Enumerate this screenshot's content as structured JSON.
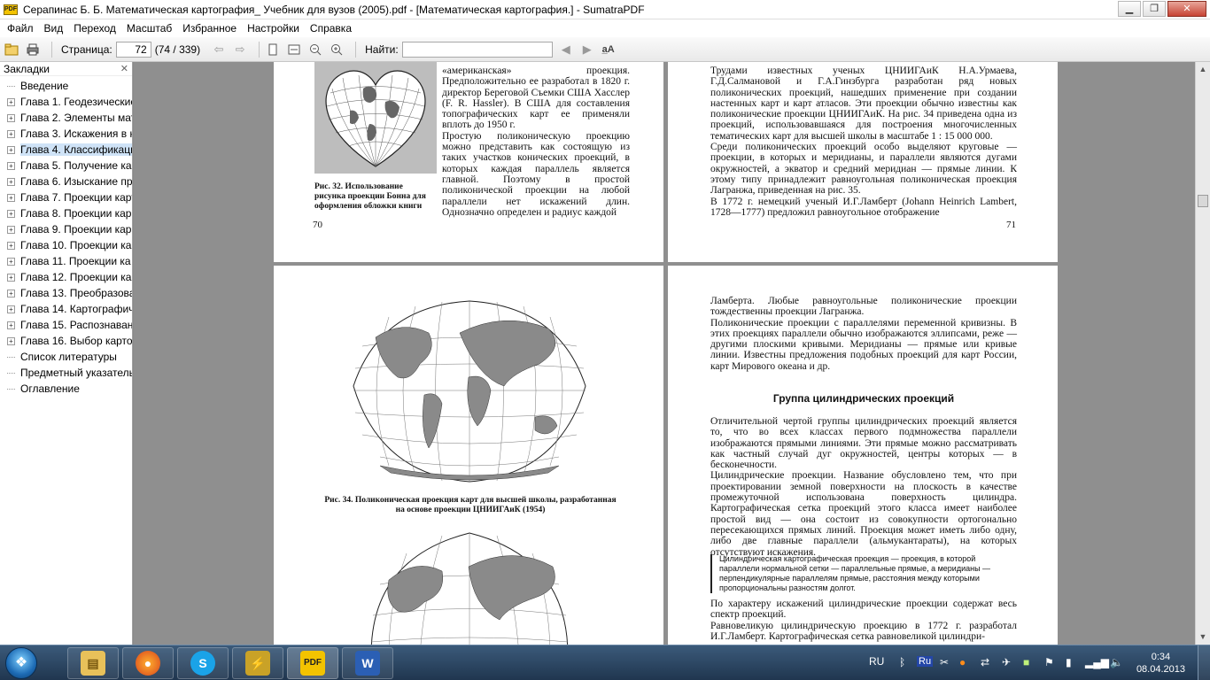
{
  "window": {
    "title": "Серапинас Б. Б. Математическая картография_ Учебник для вузов (2005).pdf - [Математическая картография.] - SumatraPDF",
    "logo_text": "PDF"
  },
  "menu": [
    "Файл",
    "Вид",
    "Переход",
    "Масштаб",
    "Избранное",
    "Настройки",
    "Справка"
  ],
  "toolbar": {
    "page_label": "Страница:",
    "page_value": "72",
    "page_count": "(74 / 339)",
    "find_label": "Найти:",
    "find_value": ""
  },
  "sidebar": {
    "title": "Закладки",
    "items": [
      {
        "label": "Введение",
        "expandable": false
      },
      {
        "label": "Глава 1. Геодезические",
        "expandable": true
      },
      {
        "label": "Глава 2. Элементы мат",
        "expandable": true
      },
      {
        "label": "Глава 3. Искажения в к",
        "expandable": true
      },
      {
        "label": "Глава 4. Классификаци",
        "expandable": true,
        "selected": true
      },
      {
        "label": "Глава 5. Получение ка",
        "expandable": true
      },
      {
        "label": "Глава 6. Изыскание пр",
        "expandable": true
      },
      {
        "label": "Глава 7. Проекции карт",
        "expandable": true
      },
      {
        "label": "Глава 8. Проекции кар",
        "expandable": true
      },
      {
        "label": "Глава 9. Проекции кар",
        "expandable": true
      },
      {
        "label": "Глава 10. Проекции ка",
        "expandable": true
      },
      {
        "label": "Глава 11. Проекции ка",
        "expandable": true
      },
      {
        "label": "Глава 12. Проекции ка",
        "expandable": true
      },
      {
        "label": "Глава 13. Преобразова",
        "expandable": true
      },
      {
        "label": "Глава 14. Картографич",
        "expandable": true
      },
      {
        "label": "Глава 15. Распознавани",
        "expandable": true
      },
      {
        "label": "Глава 16. Выбор карто",
        "expandable": true
      },
      {
        "label": "Список литературы",
        "expandable": false
      },
      {
        "label": "Предметный указатель",
        "expandable": false
      },
      {
        "label": "Оглавление",
        "expandable": false
      }
    ]
  },
  "pages": {
    "p70": {
      "text": "«американская» проекция. Предположительно ее разработал в 1820 г. директор Береговой Съемки США Хасслер (F. R. Hassler). В США для составления топографических карт ее применяли вплоть до 1950 г.\nПростую поликоническую проекцию можно представить как состоящую из таких участков конических проекций, в которых каждая параллель является главной. Поэтому в простой поликонической проекции на любой параллели нет искажений длин. Однозначно определен и радиус каждой",
      "caption": "Рис. 32. Использование рисунка проекции Бонна для оформления обложки книги",
      "number": "70"
    },
    "p71": {
      "text": "Трудами известных ученых ЦНИИГАиК Н.А.Урмаева, Г.Д.Салмановой и Г.А.Гинзбурга разработан ряд новых поликонических проекций, нашедших применение при создании настенных карт и карт атласов. Эти проекции обычно известны как поликонические проекции ЦНИИГАиК. На рис. 34 приведена одна из проекций, использовавшаяся для построения многочисленных тематических карт для высшей школы в масштабе 1 : 15 000 000.\nСреди поликонических проекций особо выделяют круговые — проекции, в которых и меридианы, и параллели являются дугами окружностей, а экватор и средний меридиан — прямые линии. К этому типу принадлежит равноугольная поликоническая проекция Лагранжа, приведенная на рис. 35.\nВ 1772 г. немецкий ученый И.Г.Ламберт (Johann Heinrich Lambert, 1728—1777) предложил равноугольное отображение",
      "number": "71"
    },
    "p72": {
      "caption": "Рис. 34. Поликоническая проекция карт для высшей школы, разработанная на основе проекции ЦНИИГАиК (1954)"
    },
    "p73": {
      "top": "Ламберта. Любые равноугольные поликонические проекции тождественны проекции Лагранжа.\nПоликонические проекции с параллелями переменной кривизны. В этих проекциях параллели обычно изображаются эллипсами, реже — другими плоскими кривыми. Меридианы — прямые или кривые линии. Известны предложения подобных проекций для карт России, карт Мирового океана и др.",
      "heading": "Группа цилиндрических проекций",
      "body": "Отличительной чертой группы цилиндрических проекций является то, что во всех классах первого подмножества параллели изображаются прямыми линиями. Эти прямые можно рассматривать как частный случай дуг окружностей, центры которых — в бесконечности.\nЦилиндрические проекции. Название обусловлено тем, что при проектировании земной поверхности на плоскость в качестве промежуточной использована поверхность цилиндра. Картографическая сетка проекций этого класса имеет наиболее простой вид — она состоит из совокупности ортогонально пересекающихся прямых линий. Проекция может иметь либо одну, либо две главные параллели (альмукантараты), на которых отсутствуют искажения.",
      "definition": "Цилиндрическая картографическая проекция — проекция, в которой параллели нормальной сетки — параллельные прямые, а меридианы — перпендикулярные параллелям прямые, расстояния между которыми пропорциональны разностям долгот.",
      "bottom": "По характеру искажений цилиндрические проекции содержат весь спектр проекций.\nРавновеликую цилиндрическую проекцию в 1772 г. разработал И.Г.Ламберт. Картографическая сетка равновеликой цилиндри-"
    }
  },
  "taskbar": {
    "apps": [
      "Проводник",
      "Firefox",
      "Skype",
      "Winamp",
      "SumatraPDF",
      "Word"
    ],
    "lang": "RU",
    "lang2": "Ru",
    "time": "0:34",
    "date": "08.04.2013"
  },
  "colors": {
    "title_bar": "#ffffff",
    "doc_background": "#8f8f8f",
    "taskbar": "#20364f",
    "selection": "#cfe3f7"
  }
}
